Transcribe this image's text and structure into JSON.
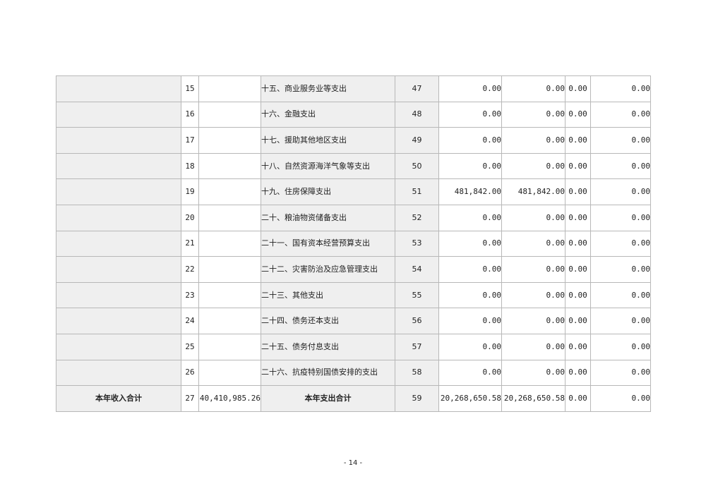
{
  "rows": [
    {
      "seq": "15",
      "item": "十五、商业服务业等支出",
      "line": "47",
      "c1": "0.00",
      "c2": "0.00",
      "c3": "0.00",
      "c4": "0.00"
    },
    {
      "seq": "16",
      "item": "十六、金融支出",
      "line": "48",
      "c1": "0.00",
      "c2": "0.00",
      "c3": "0.00",
      "c4": "0.00"
    },
    {
      "seq": "17",
      "item": "十七、援助其他地区支出",
      "line": "49",
      "c1": "0.00",
      "c2": "0.00",
      "c3": "0.00",
      "c4": "0.00"
    },
    {
      "seq": "18",
      "item": "十八、自然资源海洋气象等支出",
      "line": "50",
      "c1": "0.00",
      "c2": "0.00",
      "c3": "0.00",
      "c4": "0.00"
    },
    {
      "seq": "19",
      "item": "十九、住房保障支出",
      "line": "51",
      "c1": "481,842.00",
      "c2": "481,842.00",
      "c3": "0.00",
      "c4": "0.00"
    },
    {
      "seq": "20",
      "item": "二十、粮油物资储备支出",
      "line": "52",
      "c1": "0.00",
      "c2": "0.00",
      "c3": "0.00",
      "c4": "0.00"
    },
    {
      "seq": "21",
      "item": "二十一、国有资本经营预算支出",
      "line": "53",
      "c1": "0.00",
      "c2": "0.00",
      "c3": "0.00",
      "c4": "0.00"
    },
    {
      "seq": "22",
      "item": "二十二、灾害防治及应急管理支出",
      "line": "54",
      "c1": "0.00",
      "c2": "0.00",
      "c3": "0.00",
      "c4": "0.00"
    },
    {
      "seq": "23",
      "item": "二十三、其他支出",
      "line": "55",
      "c1": "0.00",
      "c2": "0.00",
      "c3": "0.00",
      "c4": "0.00"
    },
    {
      "seq": "24",
      "item": "二十四、债务还本支出",
      "line": "56",
      "c1": "0.00",
      "c2": "0.00",
      "c3": "0.00",
      "c4": "0.00"
    },
    {
      "seq": "25",
      "item": "二十五、债务付息支出",
      "line": "57",
      "c1": "0.00",
      "c2": "0.00",
      "c3": "0.00",
      "c4": "0.00"
    },
    {
      "seq": "26",
      "item": "二十六、抗疫特别国债安排的支出",
      "line": "58",
      "c1": "0.00",
      "c2": "0.00",
      "c3": "0.00",
      "c4": "0.00"
    }
  ],
  "total": {
    "income_label": "本年收入合计",
    "seq": "27",
    "income_amount": "40,410,985.26",
    "expense_label": "本年支出合计",
    "line": "59",
    "c1": "20,268,650.58",
    "c2": "20,268,650.58",
    "c3": "0.00",
    "c4": "0.00"
  },
  "page_number": "- 14 -"
}
